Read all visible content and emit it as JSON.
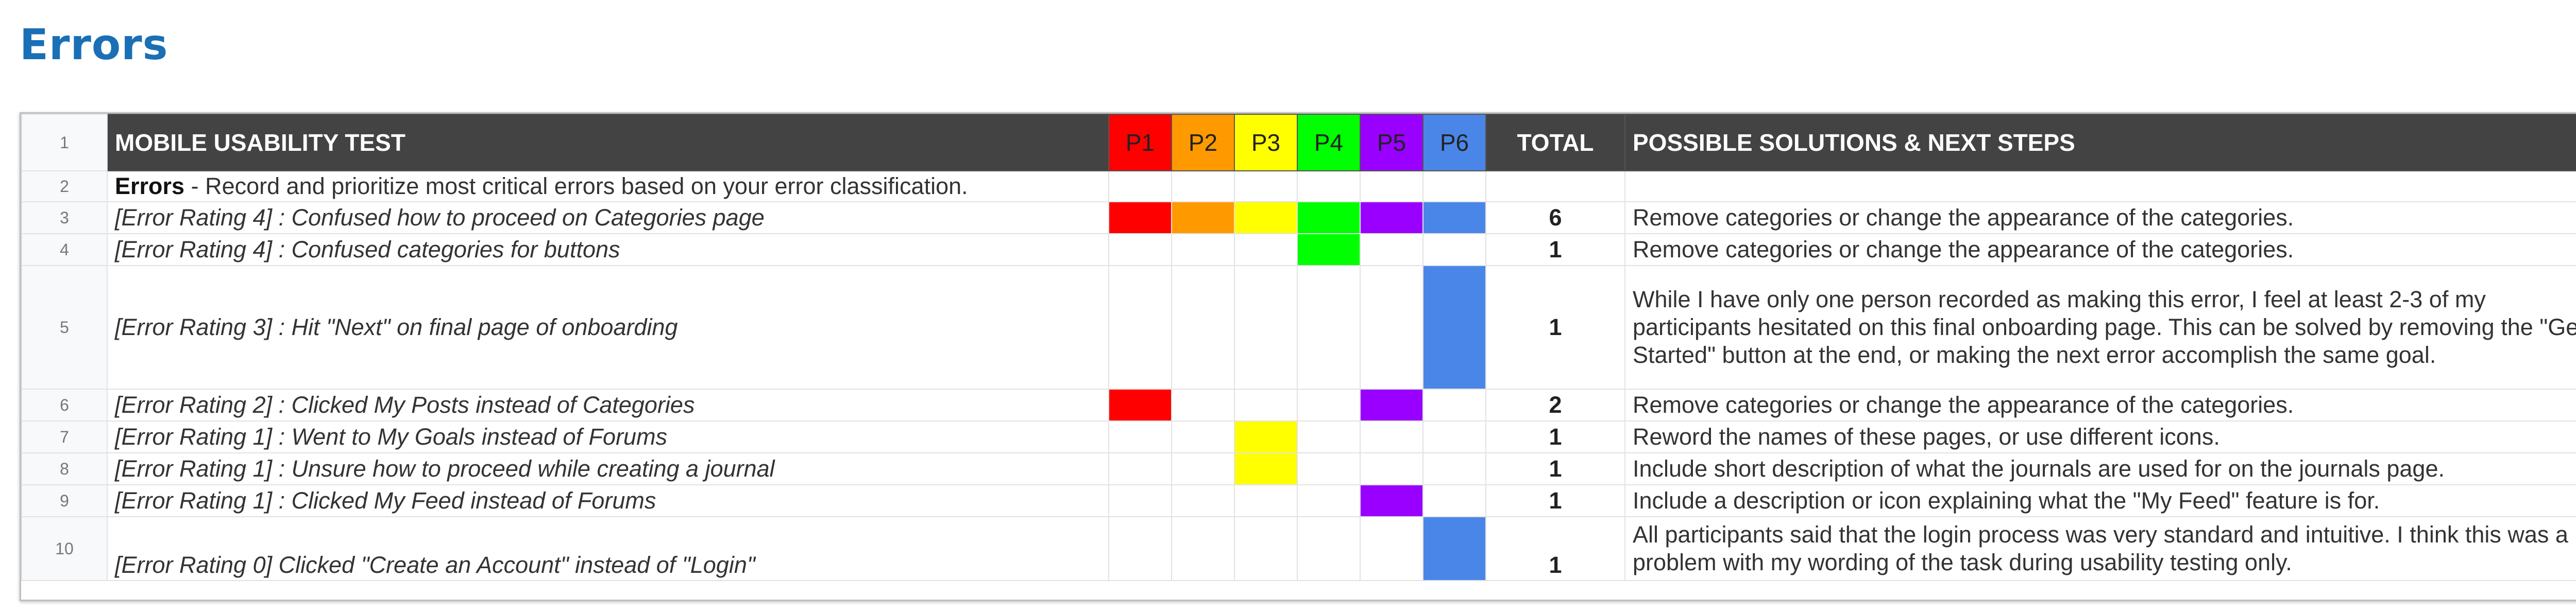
{
  "page": {
    "title": "Errors"
  },
  "colors": {
    "P1": "#ff0000",
    "P2": "#ff9900",
    "P3": "#ffff00",
    "P4": "#00ff00",
    "P5": "#9900ff",
    "P6": "#4a86e8",
    "header_bg": "#434343",
    "title": "#1a6fb5"
  },
  "sheet": {
    "header": {
      "row_number": "1",
      "test_label": "MOBILE USABILITY TEST",
      "participants": [
        "P1",
        "P2",
        "P3",
        "P4",
        "P5",
        "P6"
      ],
      "total_label": "TOTAL",
      "solutions_label": "POSSIBLE SOLUTIONS & NEXT STEPS"
    },
    "section_row": {
      "row_number": "2",
      "bold": "Errors",
      "rest": " - Record and prioritize most critical errors based on your error classification."
    },
    "rows": [
      {
        "row_number": "3",
        "error": "[Error Rating 4] : Confused how to proceed on Categories page",
        "marks": [
          true,
          true,
          true,
          true,
          true,
          true
        ],
        "total": "6",
        "solution": "Remove categories or change the appearance of the categories."
      },
      {
        "row_number": "4",
        "error": "[Error Rating 4] : Confused categories for buttons",
        "marks": [
          false,
          false,
          false,
          true,
          false,
          false
        ],
        "total": "1",
        "solution": "Remove categories or change the appearance of the categories."
      },
      {
        "row_number": "5",
        "error": "[Error Rating 3] : Hit \"Next\" on final page of onboarding",
        "marks": [
          false,
          false,
          false,
          false,
          false,
          true
        ],
        "total": "1",
        "solution": "While I have only one person recorded as making this error, I feel at least 2-3 of my participants hesitated on this final onboarding page. This can be solved by removing the \"Get Started\" button at the end, or making the next error accomplish the same goal."
      },
      {
        "row_number": "6",
        "error": "[Error Rating 2] : Clicked My Posts instead of Categories",
        "marks": [
          true,
          false,
          false,
          false,
          true,
          false
        ],
        "total": "2",
        "solution": "Remove categories or change the appearance of the categories."
      },
      {
        "row_number": "7",
        "error": "[Error Rating 1] : Went to My Goals instead of Forums",
        "marks": [
          false,
          false,
          true,
          false,
          false,
          false
        ],
        "total": "1",
        "solution": "Reword the names of these pages, or use different icons."
      },
      {
        "row_number": "8",
        "error": "[Error Rating 1] : Unsure how to proceed while creating a journal",
        "marks": [
          false,
          false,
          true,
          false,
          false,
          false
        ],
        "total": "1",
        "solution": "Include short description of what the journals are used for on the journals page."
      },
      {
        "row_number": "9",
        "error": "[Error Rating 1] : Clicked My Feed instead of Forums",
        "marks": [
          false,
          false,
          false,
          false,
          true,
          false
        ],
        "total": "1",
        "solution": "Include a description or icon explaining what the \"My Feed\" feature is for."
      },
      {
        "row_number": "10",
        "error": "[Error Rating 0] Clicked \"Create an Account\" instead of \"Login\"",
        "marks": [
          false,
          false,
          false,
          false,
          false,
          true
        ],
        "total": "1",
        "solution": "All participants said that the login process was very standard and intuitive. I think this was a problem with my wording of the task during usability testing only."
      }
    ]
  }
}
